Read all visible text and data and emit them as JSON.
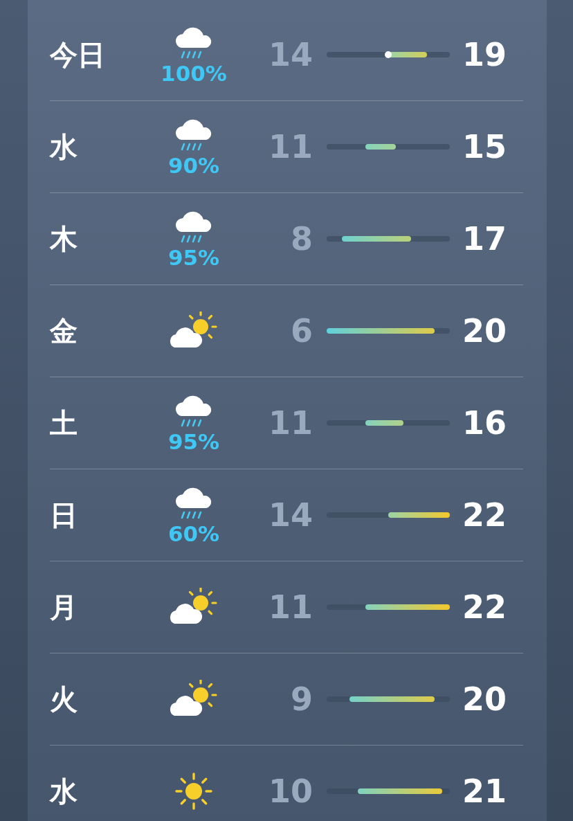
{
  "days": [
    {
      "day": "今日",
      "kind": "rain",
      "precip": "100%",
      "low": "14",
      "high": "19",
      "current_marker": true
    },
    {
      "day": "水",
      "kind": "rain",
      "precip": "90%",
      "low": "11",
      "high": "15",
      "current_marker": false
    },
    {
      "day": "木",
      "kind": "rain",
      "precip": "95%",
      "low": "8",
      "high": "17",
      "current_marker": false
    },
    {
      "day": "金",
      "kind": "partly_sunny",
      "low": "6",
      "high": "20",
      "current_marker": false
    },
    {
      "day": "土",
      "kind": "rain",
      "precip": "95%",
      "low": "11",
      "high": "16",
      "current_marker": false
    },
    {
      "day": "日",
      "kind": "rain",
      "precip": "60%",
      "low": "14",
      "high": "22",
      "current_marker": false
    },
    {
      "day": "月",
      "kind": "partly_sunny",
      "low": "11",
      "high": "22",
      "current_marker": false
    },
    {
      "day": "火",
      "kind": "partly_sunny",
      "low": "9",
      "high": "20",
      "current_marker": false
    },
    {
      "day": "水",
      "kind": "sunny",
      "low": "10",
      "high": "21",
      "current_marker": false
    }
  ]
}
